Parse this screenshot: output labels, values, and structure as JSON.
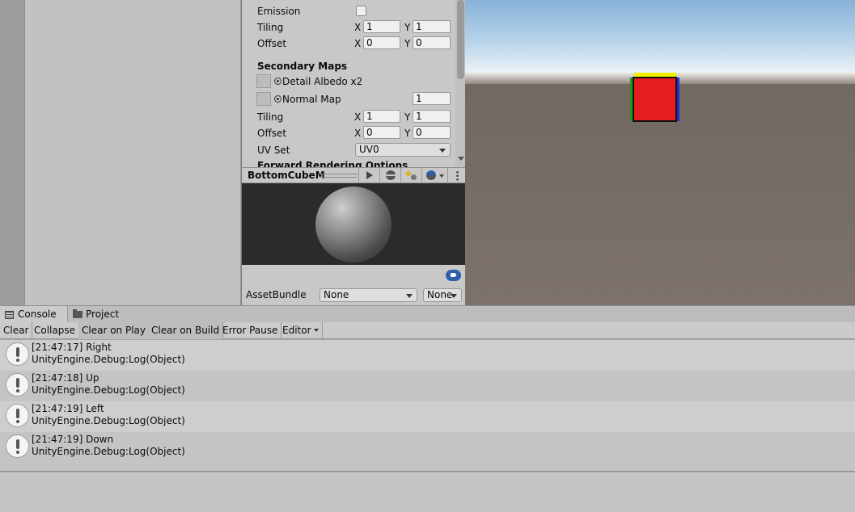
{
  "inspector": {
    "emission_label": "Emission",
    "tiling_label": "Tiling",
    "offset_label": "Offset",
    "axis_x": "X",
    "axis_y": "Y",
    "tiling_x": "1",
    "tiling_y": "1",
    "offset_x": "0",
    "offset_y": "0",
    "secondary_maps_header": "Secondary Maps",
    "detail_albedo_label": "Detail Albedo x2",
    "normal_map_label": "Normal Map",
    "normal_map_scale": "1",
    "sec_tiling_x": "1",
    "sec_tiling_y": "1",
    "sec_offset_x": "0",
    "sec_offset_y": "0",
    "uv_set_label": "UV Set",
    "uv_set_value": "UV0",
    "forward_rendering_header": "Forward Rendering Options"
  },
  "preview": {
    "title": "BottomCubeM"
  },
  "assetbundle": {
    "label": "AssetBundle",
    "name_value": "None",
    "variant_value": "None"
  },
  "console": {
    "tabs": [
      {
        "label": "Console",
        "icon": "console-icon"
      },
      {
        "label": "Project",
        "icon": "folder-icon"
      }
    ],
    "toolbar": {
      "clear": "Clear",
      "collapse": "Collapse",
      "clear_on_play": "Clear on Play",
      "clear_on_build": "Clear on Build",
      "error_pause": "Error Pause",
      "editor": "Editor"
    },
    "logs": [
      {
        "message": "[21:47:17] Right",
        "stack": "UnityEngine.Debug:Log(Object)"
      },
      {
        "message": "[21:47:18] Up",
        "stack": "UnityEngine.Debug:Log(Object)"
      },
      {
        "message": "[21:47:19] Left",
        "stack": "UnityEngine.Debug:Log(Object)"
      },
      {
        "message": "[21:47:19] Down",
        "stack": "UnityEngine.Debug:Log(Object)"
      }
    ]
  },
  "colors": {
    "cube_front": "#e51d1d",
    "cube_top": "#f0f000",
    "cube_left": "#1a9a1a",
    "cube_right": "#2030d0",
    "accent": "#2f5fa8"
  }
}
